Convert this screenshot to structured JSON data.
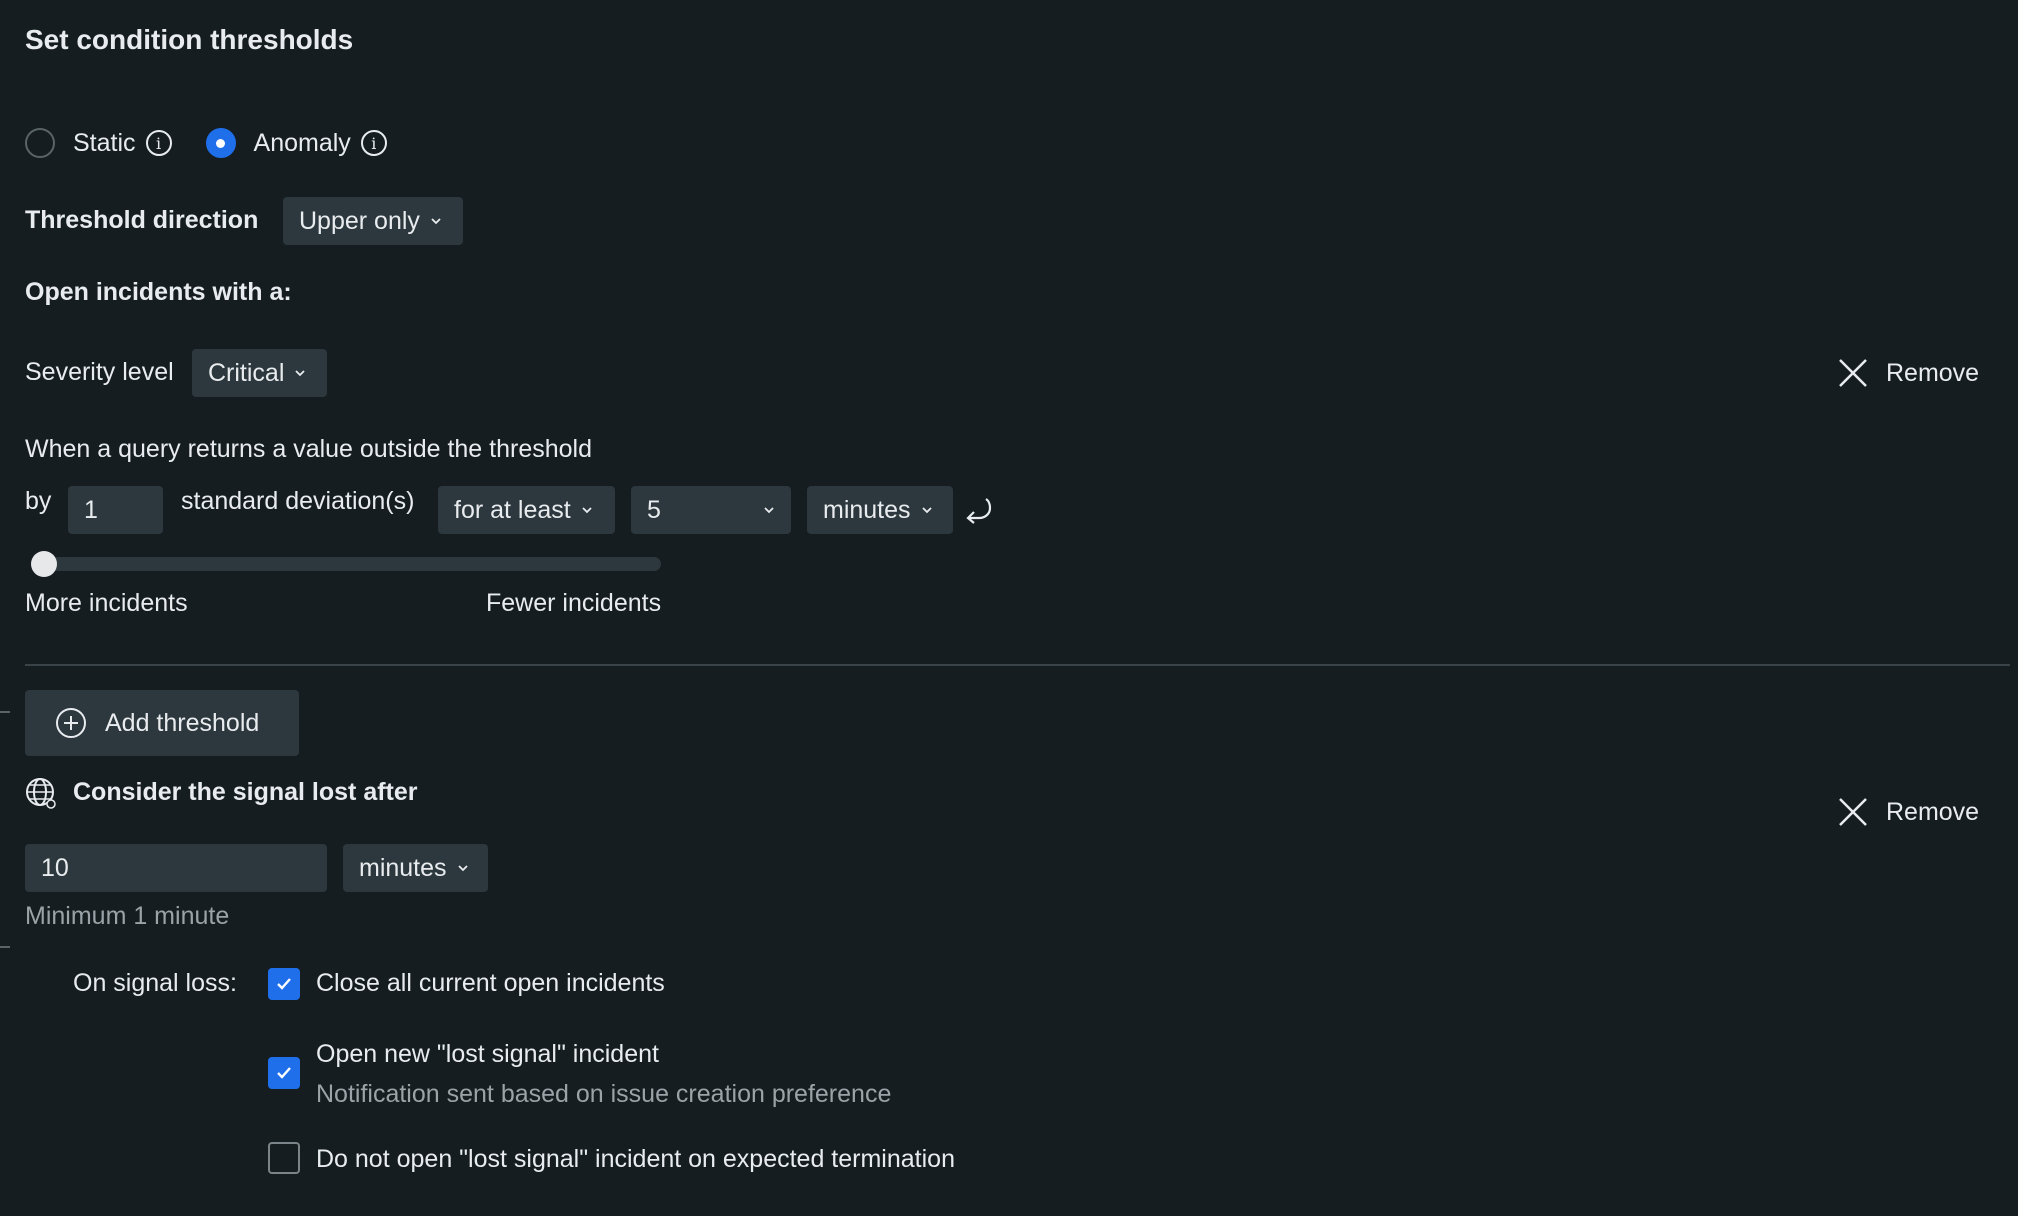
{
  "title": "Set condition thresholds",
  "threshold_type": {
    "options": [
      {
        "label": "Static",
        "selected": false
      },
      {
        "label": "Anomaly",
        "selected": true
      }
    ]
  },
  "threshold_direction": {
    "label": "Threshold direction",
    "value": "Upper only"
  },
  "open_incidents_heading": "Open incidents with a:",
  "severity": {
    "label": "Severity level",
    "value": "Critical"
  },
  "remove_label": "Remove",
  "condition": {
    "description": "When a query returns a value outside the threshold",
    "by_label": "by",
    "deviation_value": "1",
    "deviation_label": "standard deviation(s)",
    "duration_mode": "for at least",
    "duration_value": "5",
    "duration_unit": "minutes"
  },
  "sensitivity_slider": {
    "left_label": "More incidents",
    "right_label": "Fewer incidents",
    "value": 0
  },
  "add_threshold_label": "Add threshold",
  "signal_loss": {
    "heading": "Consider the signal lost after",
    "value": "10",
    "unit": "minutes",
    "hint": "Minimum 1 minute",
    "on_loss_label": "On signal loss:",
    "options": [
      {
        "label": "Close all current open incidents",
        "checked": true
      },
      {
        "label": "Open new \"lost signal\" incident",
        "sublabel": "Notification sent based on issue creation preference",
        "checked": true
      },
      {
        "label": "Do not open \"lost signal\" incident on expected termination",
        "checked": false
      }
    ]
  },
  "colors": {
    "accent": "#1f6feb",
    "background": "#151d20",
    "control": "#2c383e"
  },
  "icons": [
    "info-icon",
    "chevron-down-icon",
    "close-icon",
    "reset-icon",
    "plus-circle-icon",
    "globe-icon",
    "check-icon"
  ]
}
